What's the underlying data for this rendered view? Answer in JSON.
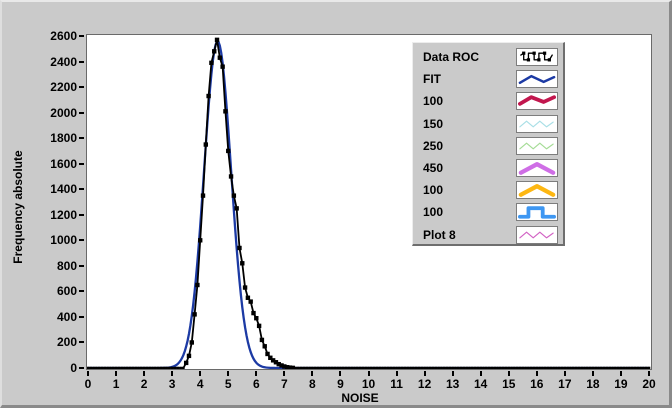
{
  "chart_data": {
    "type": "line",
    "title": "",
    "xlabel": "NOISE",
    "ylabel": "Frequency absolute",
    "xlim": [
      0,
      20
    ],
    "ylim": [
      0,
      2600
    ],
    "x_ticks": [
      0,
      1,
      2,
      3,
      4,
      5,
      6,
      7,
      8,
      9,
      10,
      11,
      12,
      13,
      14,
      15,
      16,
      17,
      18,
      19,
      20
    ],
    "y_ticks": [
      0,
      200,
      400,
      600,
      800,
      1000,
      1200,
      1400,
      1600,
      1800,
      2000,
      2200,
      2400,
      2600
    ],
    "grid": "off",
    "plot_bg": "#ffffff",
    "legend_position": "top-right",
    "series": [
      {
        "name": "Data ROC",
        "type": "line-with-square-markers",
        "color": "#000000",
        "line_width": 1.8,
        "x_step": 0.1,
        "x_range": [
          0,
          20
        ],
        "baseline_value": 0,
        "nonzero_x_start": 3.5,
        "nonzero_y": [
          40,
          95,
          200,
          420,
          650,
          1000,
          1350,
          1750,
          2130,
          2390,
          2480,
          2570,
          2430,
          2360,
          2010,
          1700,
          1500,
          1350,
          1250,
          940,
          820,
          630,
          550,
          520,
          430,
          390,
          330,
          220,
          170,
          110,
          80,
          60,
          45,
          30,
          20,
          12,
          6,
          3,
          1
        ]
      },
      {
        "name": "FIT",
        "type": "gaussian-curve",
        "color": "#1c3aa4",
        "line_width": 2.3,
        "amplitude": 2560,
        "mean": 4.62,
        "sigma": 0.48
      }
    ]
  },
  "legend": {
    "items": [
      {
        "label": "Data ROC",
        "color": "#000000",
        "style": "marker-line"
      },
      {
        "label": "FIT",
        "color": "#1c3aa4",
        "style": "zigzag-med"
      },
      {
        "label": "100",
        "color": "#c2174e",
        "style": "zigzag-thick"
      },
      {
        "label": "150",
        "color": "#a9dfe6",
        "style": "zigzag-thin"
      },
      {
        "label": "250",
        "color": "#a5dc96",
        "style": "zigzag-thin"
      },
      {
        "label": "450",
        "color": "#cf6ee6",
        "style": "chevron-thick"
      },
      {
        "label": "100",
        "color": "#fdb713",
        "style": "chevron-thick"
      },
      {
        "label": "100",
        "color": "#3e97f2",
        "style": "step-thick"
      },
      {
        "label": "Plot 8",
        "color": "#d263c4",
        "style": "zigzag-thin"
      }
    ]
  },
  "colors": {
    "window_bg": "#cacaca",
    "plot_bg": "#ffffff",
    "axis_text": "#000000"
  }
}
